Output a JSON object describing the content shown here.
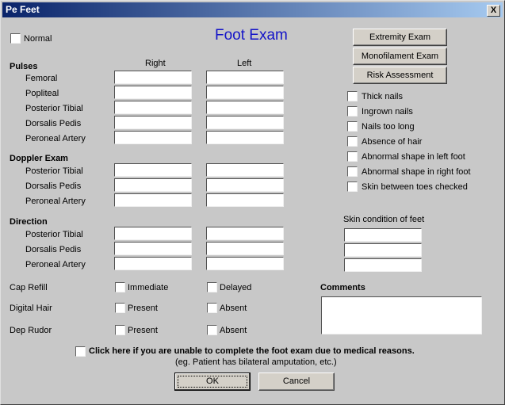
{
  "window": {
    "title": "Pe Feet",
    "close_label": "X"
  },
  "heading": "Foot Exam",
  "normal_checkbox": {
    "label": "Normal",
    "checked": false
  },
  "columns": {
    "right": "Right",
    "left": "Left"
  },
  "pulses": {
    "title": "Pulses",
    "rows": [
      "Femoral",
      "Popliteal",
      "Posterior Tibial",
      "Dorsalis Pedis",
      "Peroneal Artery"
    ]
  },
  "doppler": {
    "title": "Doppler Exam",
    "rows": [
      "Posterior Tibial",
      "Dorsalis Pedis",
      "Peroneal Artery"
    ]
  },
  "direction": {
    "title": "Direction",
    "rows": [
      "Posterior Tibial",
      "Dorsalis Pedis",
      "Peroneal Artery"
    ]
  },
  "checkbox_rows": [
    {
      "label": "Cap Refill",
      "opt1": "Immediate",
      "opt2": "Delayed"
    },
    {
      "label": "Digital Hair",
      "opt1": "Present",
      "opt2": "Absent"
    },
    {
      "label": "Dep Rudor",
      "opt1": "Present",
      "opt2": "Absent"
    }
  ],
  "side_buttons": [
    "Extremity Exam",
    "Monofilament Exam",
    "Risk Assessment"
  ],
  "findings": [
    "Thick nails",
    "Ingrown nails",
    "Nails too long",
    "Absence of hair",
    "Abnormal shape in left foot",
    "Abnormal shape in right foot",
    "Skin between toes checked"
  ],
  "skin_condition": {
    "label": "Skin condition of feet",
    "values": [
      "",
      "",
      ""
    ]
  },
  "comments": {
    "label": "Comments",
    "value": ""
  },
  "medical_reasons": {
    "label": "Click here if you are unable to complete the foot exam due to medical reasons.",
    "note": "(eg. Patient has bilateral amputation, etc.)"
  },
  "buttons": {
    "ok": "OK",
    "cancel": "Cancel"
  }
}
